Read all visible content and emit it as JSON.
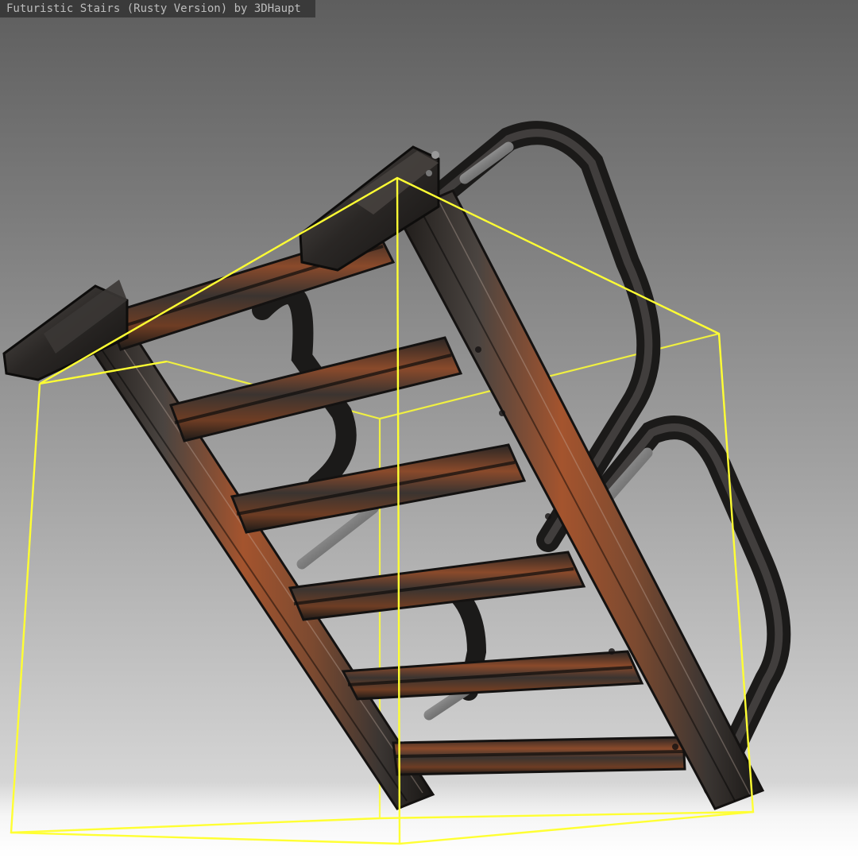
{
  "viewport": {
    "title": "Futuristic Stairs (Rusty Version) by 3DHaupt",
    "model_name": "futuristic-rusty-stairs",
    "bounding_box_visible": true,
    "colors": {
      "background_top": "#5e5e5e",
      "background_bottom": "#ededed",
      "bounding_box": "#ffff33",
      "rust": "#a4542e",
      "dark_metal": "#2b2826",
      "steel": "#8d8d8d"
    }
  }
}
